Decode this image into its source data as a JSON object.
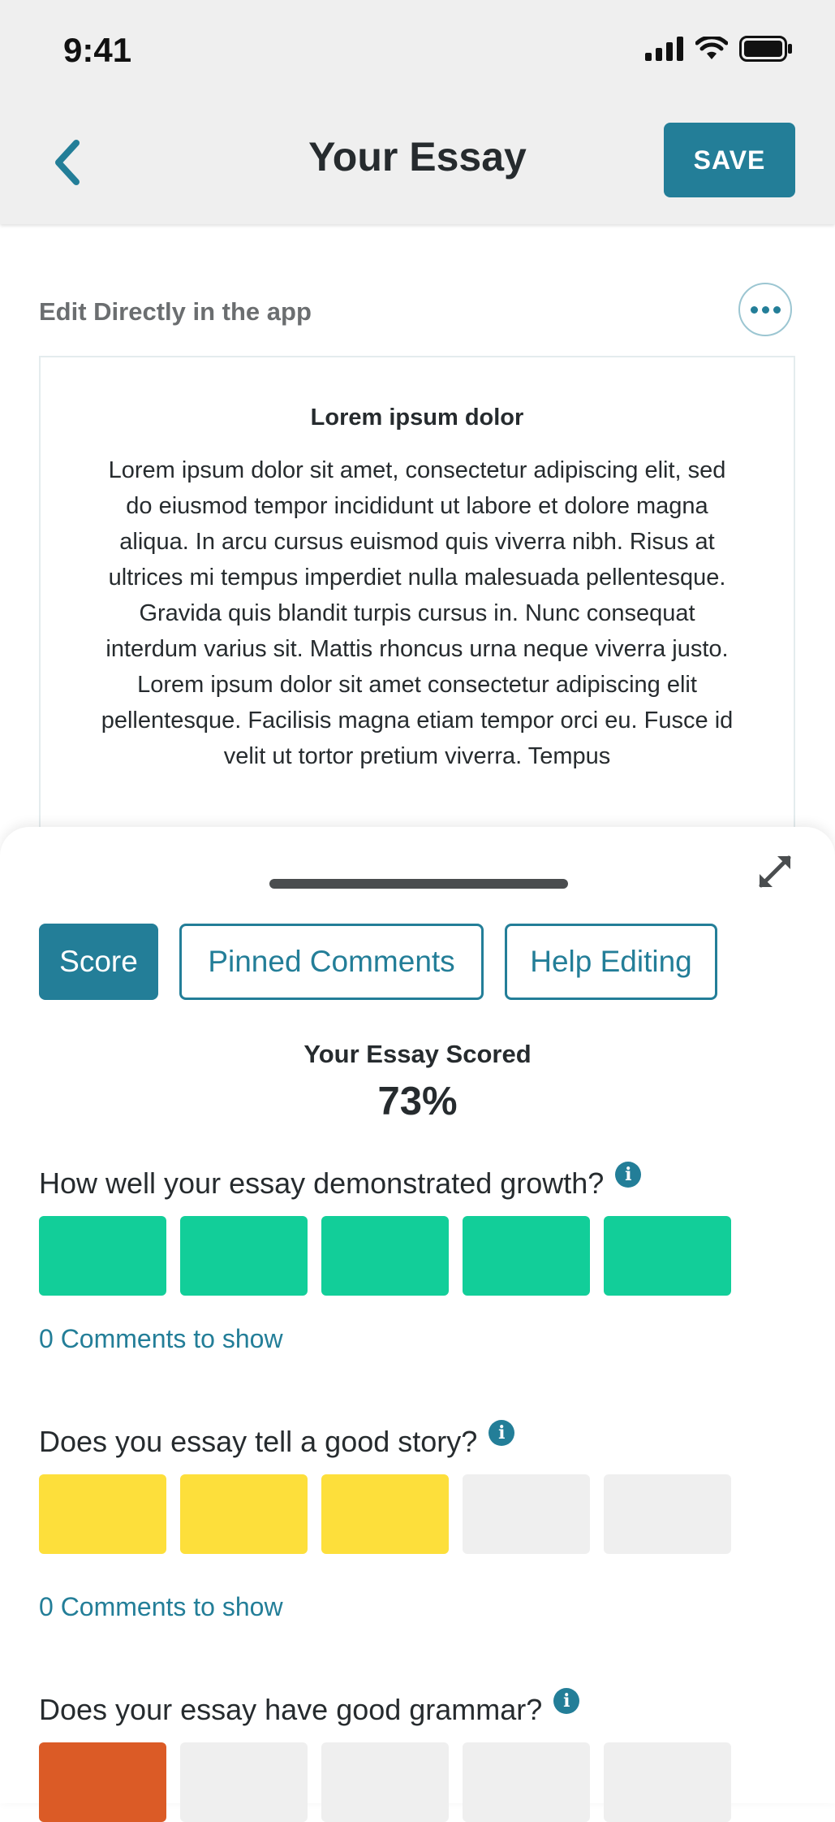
{
  "status_bar": {
    "time": "9:41"
  },
  "header": {
    "title": "Your Essay",
    "save_label": "SAVE"
  },
  "editor": {
    "label": "Edit Directly in the app",
    "essay_title": "Lorem ipsum dolor",
    "essay_body": "Lorem ipsum dolor sit amet, consectetur adipiscing elit, sed do eiusmod tempor incididunt ut labore et dolore magna aliqua. In arcu cursus euismod quis viverra nibh. Risus at ultrices mi tempus imperdiet nulla malesuada pellentesque. Gravida quis blandit turpis cursus in. Nunc consequat interdum varius sit. Mattis rhoncus urna neque viverra justo. Lorem ipsum dolor sit amet consectetur adipiscing elit pellentesque. Facilisis magna etiam tempor orci eu. Fusce id velit ut tortor pretium viverra. Tempus"
  },
  "tabs": [
    {
      "label": "Score",
      "active": true
    },
    {
      "label": "Pinned Comments",
      "active": false
    },
    {
      "label": "Help Editing",
      "active": false
    }
  ],
  "score": {
    "label": "Your Essay Scored",
    "value": "73%"
  },
  "questions": [
    {
      "text": "How well your essay demonstrated growth?",
      "rating": 5,
      "max": 5,
      "color": "#12ce99",
      "comments": "0 Comments to show"
    },
    {
      "text": "Does you essay tell a good story?",
      "rating": 3,
      "max": 5,
      "color": "#fddf3b",
      "comments": "0 Comments to show"
    },
    {
      "text": "Does your essay have good grammar?",
      "rating": 1,
      "max": 5,
      "color": "#db5b26"
    }
  ],
  "colors": {
    "accent": "#237e98",
    "header_bg": "#efefef",
    "empty_block": "#efefef"
  },
  "icons": [
    "back-chevron-icon",
    "more-icon",
    "expand-icon",
    "info-icon",
    "signal-icon",
    "wifi-icon",
    "battery-icon"
  ]
}
